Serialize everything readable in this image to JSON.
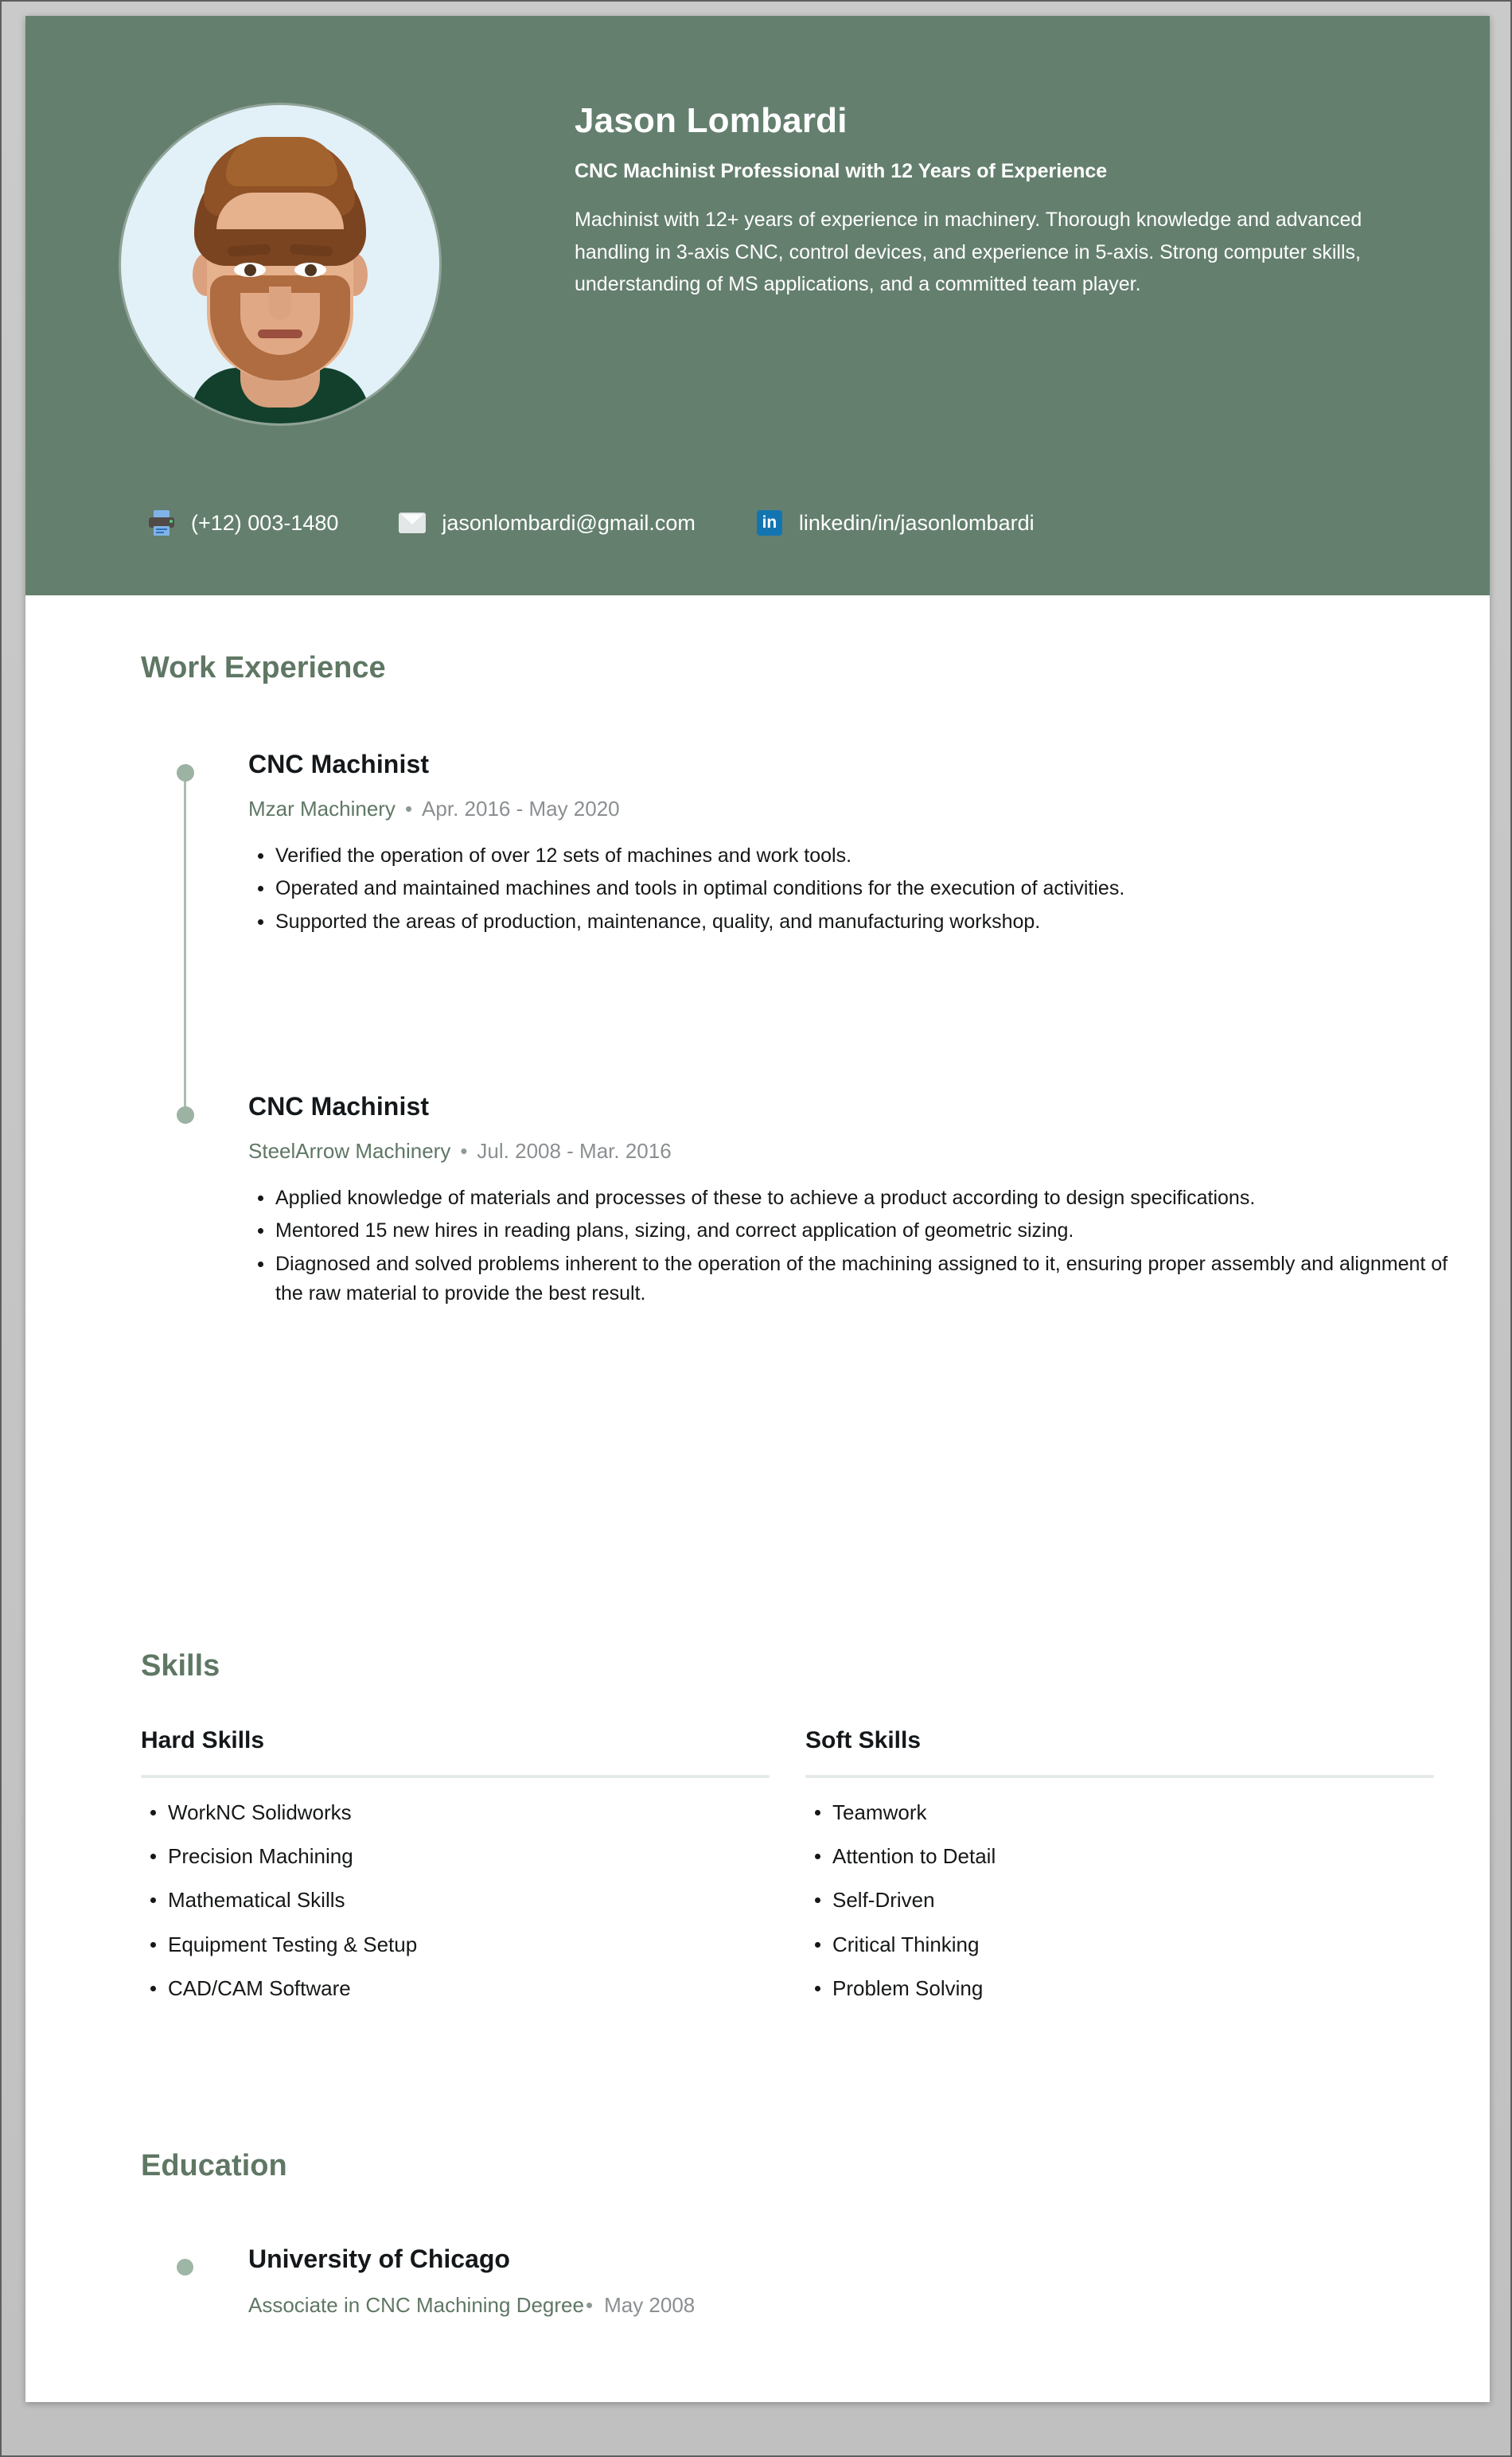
{
  "theme": {
    "header_bg": "#647f6e",
    "heading_green": "#5f7764",
    "company_green": "#5f7764",
    "date_gray": "#8b8f91",
    "timeline_dot": "#9cb3a3",
    "rule_color": "#e4eae5",
    "photo_bg": "#e2f1f8",
    "linkedin_blue": "#1275b1",
    "page_bg": "#ffffff",
    "canvas_bg": "#c6c6c6"
  },
  "header": {
    "name": "Jason Lombardi",
    "headline": "CNC Machinist Professional with 12 Years of Experience",
    "summary": "Machinist with 12+ years of experience in machinery. Thorough knowledge and advanced handling in 3-axis CNC, control devices, and experience in 5-axis. Strong computer skills, understanding of MS applications, and a committed team player.",
    "photo_alt": "profile-photo"
  },
  "contacts": [
    {
      "icon": "fax-icon",
      "value": "(+12) 003-1480"
    },
    {
      "icon": "envelope-icon",
      "value": "jasonlombardi@gmail.com"
    },
    {
      "icon": "linkedin-icon",
      "value": "linkedin/in/jasonlombardi",
      "icon_text": "in"
    }
  ],
  "sections": {
    "work": {
      "title": "Work Experience"
    },
    "skills": {
      "title": "Skills"
    },
    "education": {
      "title": "Education"
    }
  },
  "work_experience": [
    {
      "title": "CNC Machinist",
      "company": "Mzar Machinery",
      "separator": "•",
      "dates": "Apr. 2016 - May 2020",
      "bullets": [
        "Verified the operation of over 12 sets of machines and work tools.",
        "Operated and maintained machines and tools in optimal conditions for the execution of activities.",
        "Supported the areas of production, maintenance, quality, and manufacturing workshop."
      ]
    },
    {
      "title": "CNC Machinist",
      "company": "SteelArrow Machinery",
      "separator": "•",
      "dates": "Jul. 2008 - Mar. 2016",
      "bullets": [
        "Applied knowledge of materials and processes of these to achieve a product according to design specifications.",
        "Mentored 15 new hires in reading plans, sizing, and correct application of geometric sizing.",
        "Diagnosed and solved problems inherent to the operation of the machining assigned to it, ensuring proper assembly and alignment of the raw material to provide the best result."
      ]
    }
  ],
  "skills": {
    "columns": [
      {
        "heading": "Hard Skills",
        "items": [
          "WorkNC Solidworks",
          "Precision Machining",
          "Mathematical Skills",
          "Equipment Testing & Setup",
          "CAD/CAM Software"
        ]
      },
      {
        "heading": "Soft Skills",
        "items": [
          "Teamwork",
          "Attention to Detail",
          "Self-Driven",
          "Critical Thinking",
          "Problem Solving"
        ]
      }
    ]
  },
  "education": [
    {
      "school": "University of Chicago",
      "degree": "Associate in CNC Machining Degree",
      "separator": "•",
      "date": "May 2008"
    }
  ]
}
